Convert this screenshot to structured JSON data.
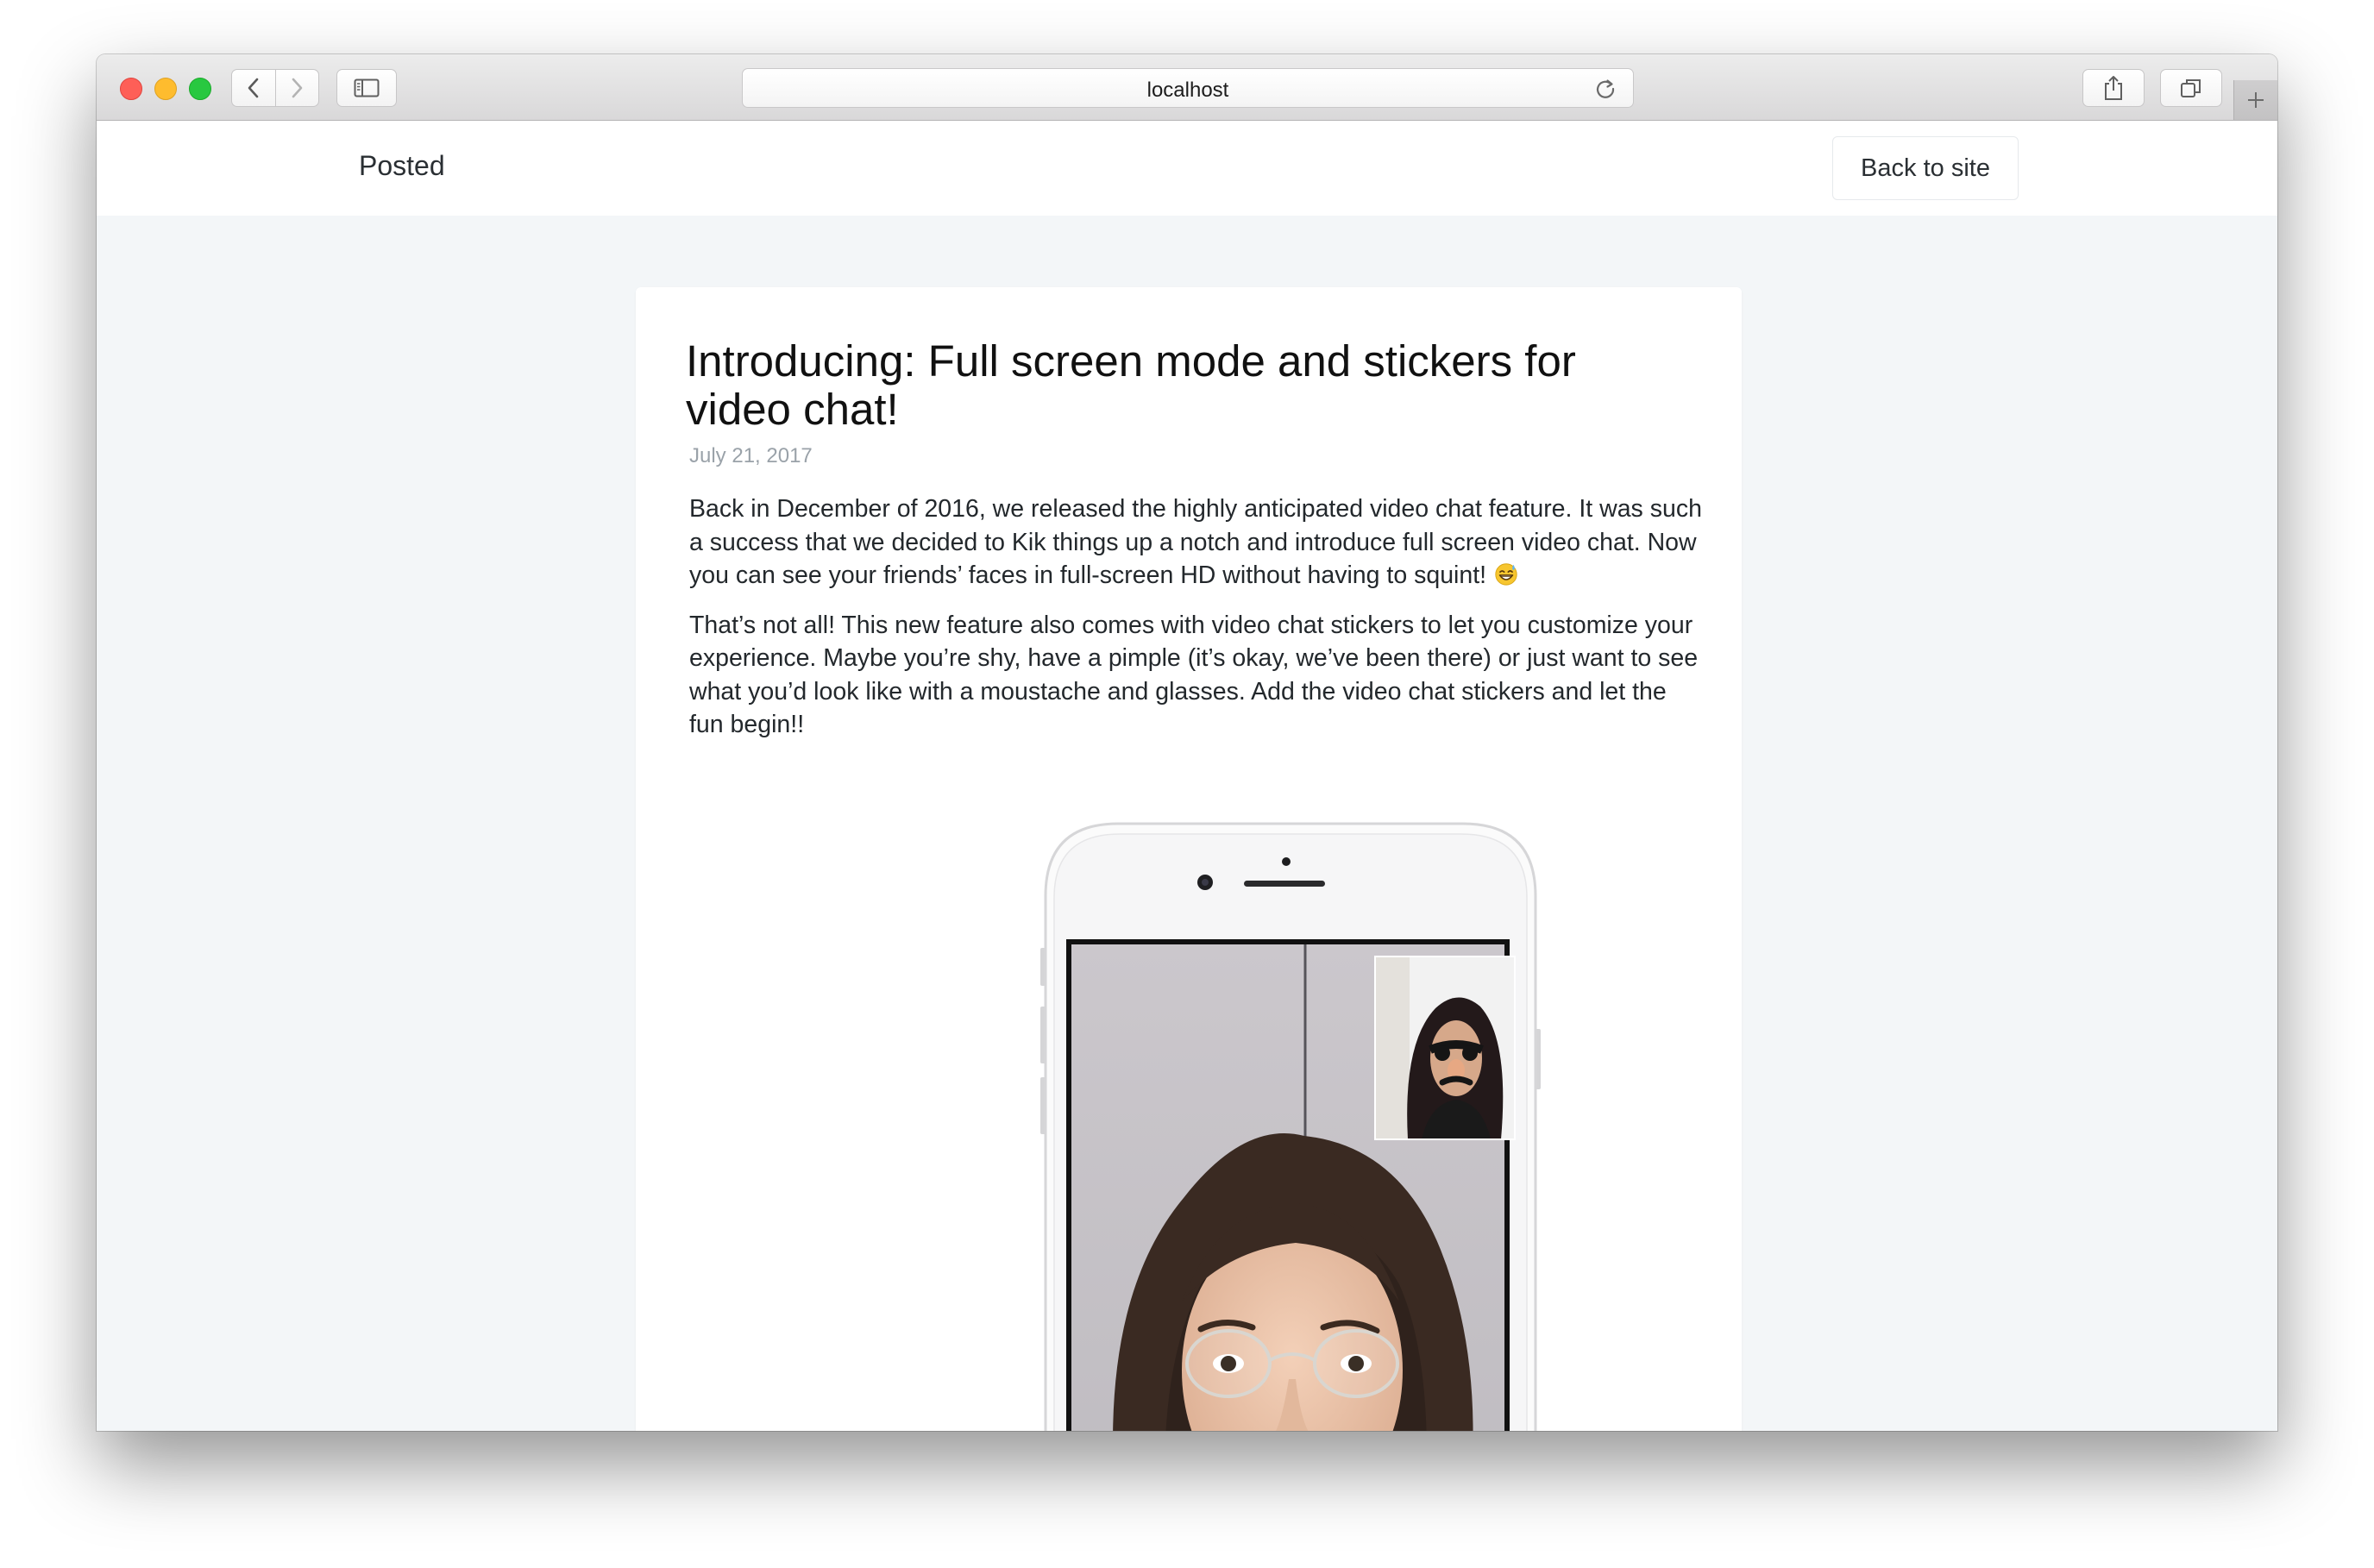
{
  "browser": {
    "url": "localhost",
    "icons": {
      "back": "chevron-left-icon",
      "forward": "chevron-right-icon",
      "sidebar": "sidebar-icon",
      "reload": "reload-icon",
      "share": "share-icon",
      "tabs": "tabs-overview-icon",
      "new_tab": "plus-icon"
    },
    "traffic_colors": {
      "close": "#fe5f57",
      "minimize": "#febc2e",
      "zoom": "#28c840"
    }
  },
  "site": {
    "brand": "Posted",
    "back_button": "Back to site"
  },
  "post": {
    "title": "Introducing: Full screen mode and stickers for video chat!",
    "date": "July 21, 2017",
    "paragraph_1": "Back in December of 2016, we released the highly anticipated video chat feature. It was such a success that we decided to Kik things up a notch and introduce full screen video chat. Now you can see your friends’ faces in full-screen HD without having to squint!",
    "paragraph_1_emoji": "grinning-sweat-emoji",
    "paragraph_2": "That’s not all! This new feature also comes with video chat stickers to let you customize your experience. Maybe you’re shy, have a pimple (it’s okay, we’ve been there) or just want to see what you’d look like with a moustache and glasses. Add the video chat stickers and let the fun begin!!",
    "image": "phone-video-chat-image"
  },
  "colors": {
    "page_background": "#f3f6f8",
    "card_background": "#ffffff",
    "date_text": "#9aa2a9"
  }
}
